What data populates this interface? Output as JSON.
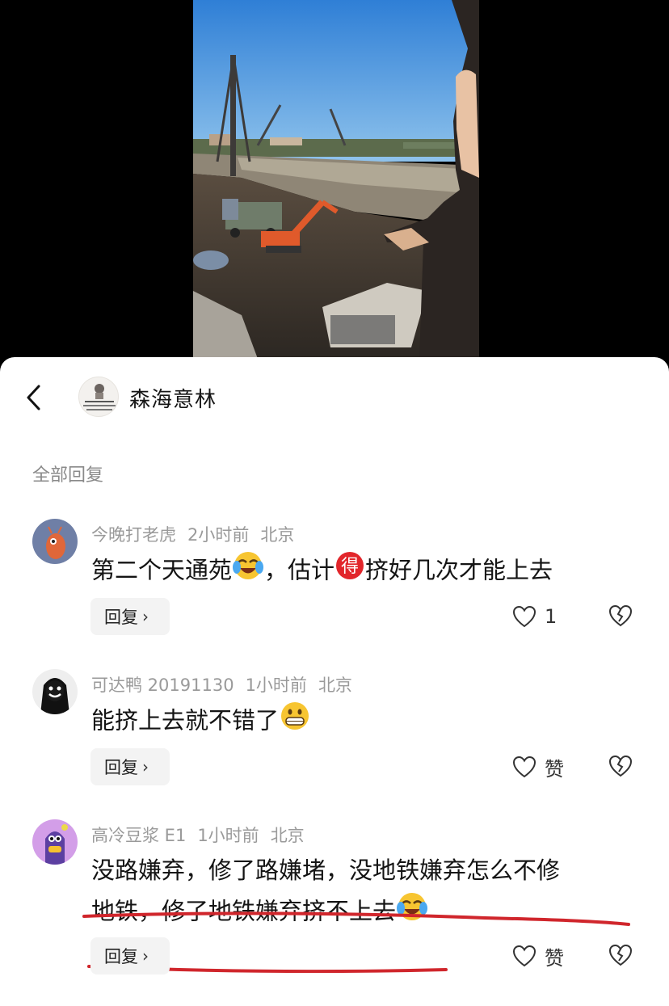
{
  "video": {
    "description_icon": "construction-site-video"
  },
  "header": {
    "back_icon": "chevron-left-icon",
    "name": "森海意林"
  },
  "section_title": "全部回复",
  "comments": [
    {
      "username": "今晚打老虎",
      "time": "2小时前",
      "location": "北京",
      "text_a": "第二个天通苑",
      "text_b": "，估计",
      "text_c": "挤好几次才能上去",
      "reply_label": "回复",
      "like_label": "1"
    },
    {
      "username": "可达鸭 20191130",
      "time": "1小时前",
      "location": "北京",
      "text_a": "能挤上去就不错了",
      "reply_label": "回复",
      "like_label": "赞"
    },
    {
      "username": "高冷豆浆 E1",
      "time": "1小时前",
      "location": "北京",
      "text_line1": "没路嫌弃，修了路嫌堵，没地铁嫌弃怎么不修",
      "text_line2": "地铁，修了地铁嫌弃挤不上去",
      "reply_label": "回复",
      "like_label": "赞"
    }
  ],
  "colors": {
    "underline": "#d0262c",
    "meta": "#9a9a9a",
    "reply_bg": "#f3f3f3"
  }
}
